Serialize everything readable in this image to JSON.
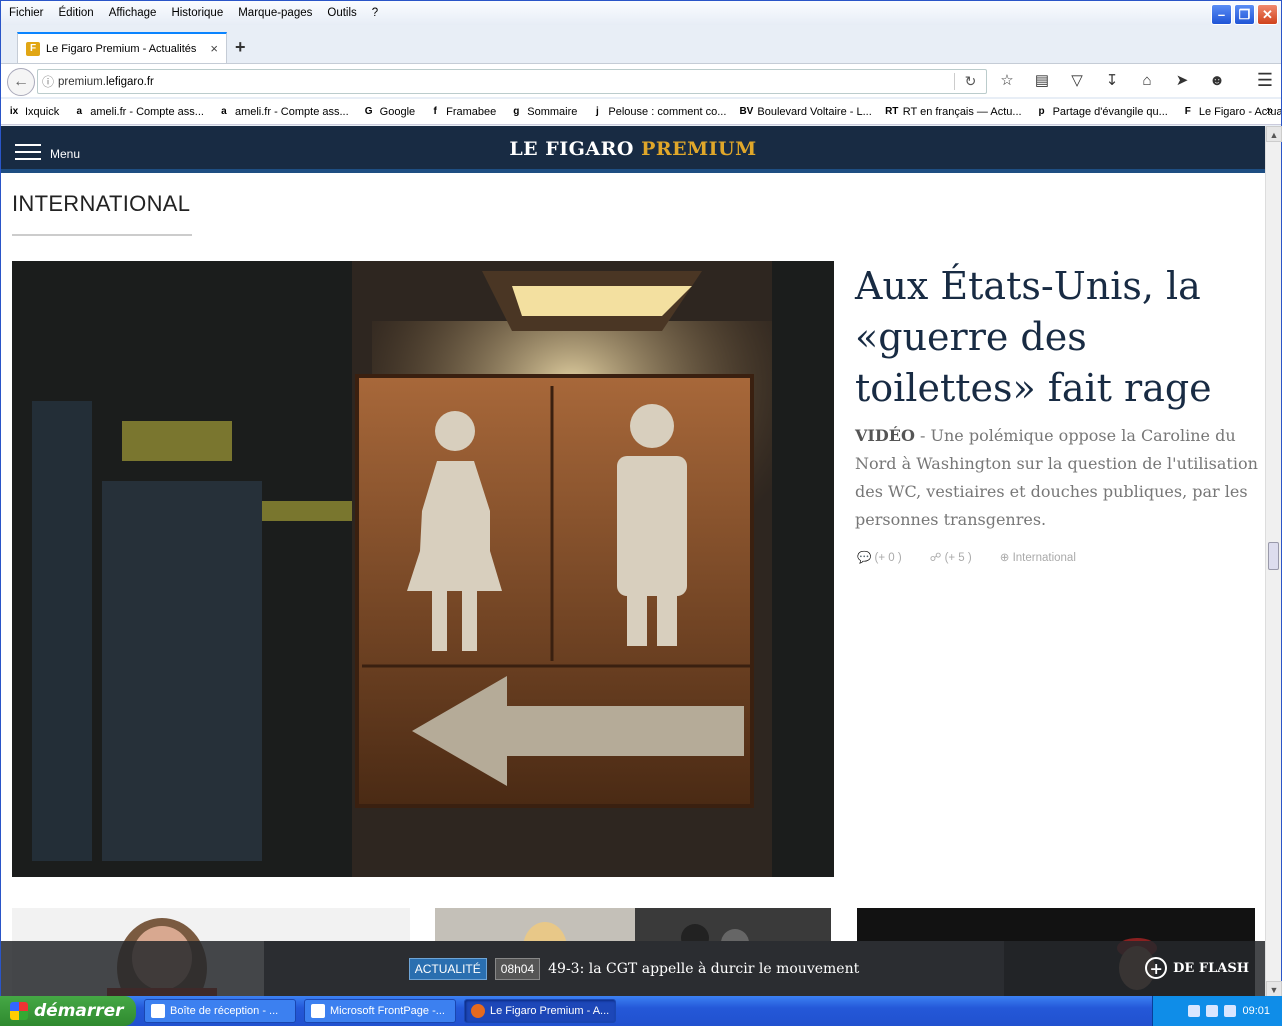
{
  "window": {
    "menu": [
      "Fichier",
      "Édition",
      "Affichage",
      "Historique",
      "Marque-pages",
      "Outils",
      "?"
    ]
  },
  "tab": {
    "title": "Le Figaro Premium - Actualités",
    "close": "×",
    "new": "+"
  },
  "nav": {
    "url_prefix": "premium.",
    "url_domain": "lefigaro.fr"
  },
  "bookmarks": [
    {
      "label": "Ixquick",
      "icon": "ix"
    },
    {
      "label": "ameli.fr - Compte ass...",
      "icon": "a"
    },
    {
      "label": "ameli.fr - Compte ass...",
      "icon": "a"
    },
    {
      "label": "Google",
      "icon": "G"
    },
    {
      "label": "Framabee",
      "icon": "f"
    },
    {
      "label": "Sommaire",
      "icon": "g"
    },
    {
      "label": "Pelouse : comment co...",
      "icon": "j"
    },
    {
      "label": "Boulevard Voltaire - L...",
      "icon": "BV"
    },
    {
      "label": "RT en français — Actu...",
      "icon": "RT"
    },
    {
      "label": "Partage d'évangile qu...",
      "icon": "p"
    },
    {
      "label": "Le Figaro - Actualités",
      "icon": "F"
    }
  ],
  "bookmarks_more": "»",
  "site": {
    "menu_label": "Menu",
    "logo_main": "LE FIGARO ",
    "logo_accent": "PREMIUM",
    "section": "INTERNATIONAL"
  },
  "article": {
    "title": "Aux États-Unis, la «guerre des toilettes» fait rage",
    "kicker": "VIDÉO",
    "description": " - Une polémique oppose la Caroline du Nord à Washington sur la question de l'utilisation des WC, vestiaires et douches publiques, par les personnes transgenres.",
    "comments": "(+ 0 )",
    "shares": "(+ 5 )",
    "category": "International"
  },
  "flash": {
    "tag": "ACTUALITÉ",
    "time": "08h04",
    "text": "49-3: la CGT appelle à durcir le mouvement",
    "more": "DE FLASH"
  },
  "taskbar": {
    "start": "démarrer",
    "tasks": [
      "Boîte de réception - ...",
      "Microsoft FrontPage -...",
      "Le Figaro Premium - A..."
    ],
    "clock": "09:01"
  }
}
